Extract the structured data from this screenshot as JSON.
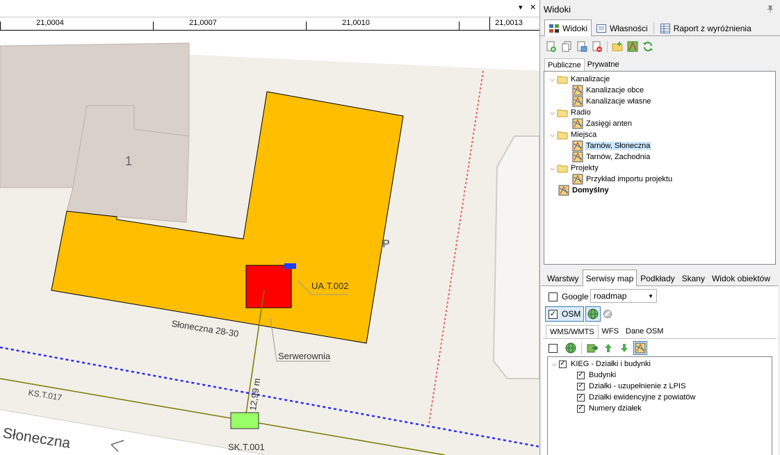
{
  "map": {
    "ruler_ticks": [
      "21,0004",
      "21,0007",
      "21,0010",
      "21,0013"
    ],
    "window_controls": [
      "▾",
      "✕"
    ],
    "building_number": "1",
    "parking_label": "P",
    "labels": {
      "ua": "UA.T.002",
      "address": "Słoneczna 28-30",
      "server_room": "Serwerownia",
      "distance": "12,99 m",
      "kstu": "KS.T.017",
      "street": "Słoneczna",
      "sk": "SK.T.001"
    }
  },
  "panel": {
    "title": "Widoki",
    "tabs": [
      "Widoki",
      "Własności",
      "Raport z wyróżnienia"
    ],
    "subtabs": [
      "Publiczne",
      "Prywatne"
    ],
    "tree": [
      {
        "label": "Kanalizacje",
        "type": "folder",
        "level": 0
      },
      {
        "label": "Kanalizacje obce",
        "type": "view",
        "level": 1
      },
      {
        "label": "Kanalizacje własne",
        "type": "view",
        "level": 1
      },
      {
        "label": "Radio",
        "type": "folder",
        "level": 0
      },
      {
        "label": "Zasięgi anten",
        "type": "view",
        "level": 1
      },
      {
        "label": "Miejsca",
        "type": "folder",
        "level": 0
      },
      {
        "label": "Tarnów, Słoneczna",
        "type": "view",
        "level": 1,
        "selected": true
      },
      {
        "label": "Tarnów, Zachodnia",
        "type": "view",
        "level": 1
      },
      {
        "label": "Projekty",
        "type": "folder",
        "level": 0
      },
      {
        "label": "Przykład importu projektu",
        "type": "view",
        "level": 1
      },
      {
        "label": "Domyślny",
        "type": "view",
        "level": 0,
        "bold": true
      }
    ],
    "bottom_tabs": [
      "Warstwy",
      "Serwisy map",
      "Podkłady",
      "Skany",
      "Widok obiektów"
    ],
    "google": {
      "label": "Google",
      "checked": false,
      "map_type": "roadmap"
    },
    "osm": {
      "label": "OSM",
      "checked": true
    },
    "service_tabs": [
      "WMS/WMTS",
      "WFS",
      "Dane OSM"
    ],
    "layers": {
      "root": "KIEG - Działki i budynki",
      "children": [
        "Budynki",
        "Działki - uzupełnienie z LPIS",
        "Działki ewidencyjne z powiatów",
        "Numery działek"
      ]
    }
  }
}
